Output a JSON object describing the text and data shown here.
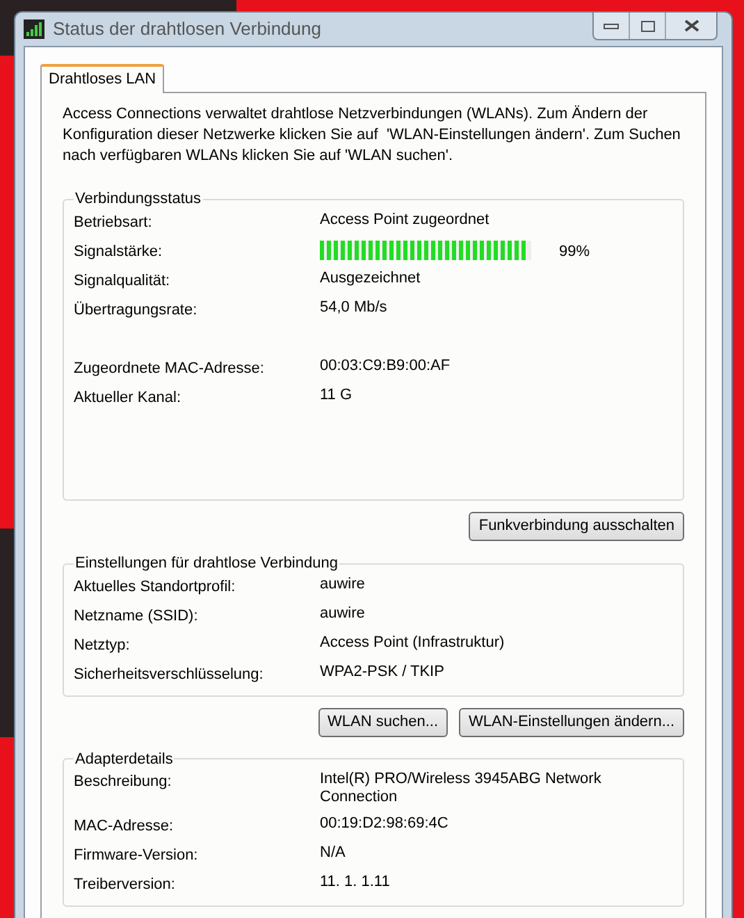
{
  "window": {
    "title": "Status der drahtlosen Verbindung"
  },
  "tabs": [
    {
      "label": "Drahtloses LAN",
      "selected": true
    }
  ],
  "intro": "Access Connections verwaltet drahtlose Netzverbindungen (WLANs). Zum Ändern der Konfiguration dieser Netzwerke klicken Sie auf  'WLAN-Einstellungen ändern'. Zum Suchen nach verfügbaren WLANs klicken Sie auf 'WLAN suchen'.",
  "connection_status": {
    "title": "Verbindungsstatus",
    "rows": [
      {
        "kind": "text",
        "label": "Betriebsart:",
        "value": "Access Point zugeordnet"
      },
      {
        "kind": "meter",
        "label": "Signalstärke:",
        "level": 0.99,
        "value": "99%"
      },
      {
        "kind": "text",
        "label": "Signalqualität:",
        "value": "Ausgezeichnet"
      },
      {
        "kind": "text",
        "label": "Übertragungsrate:",
        "value": "54,0 Mb/s"
      }
    ],
    "more_rows": [
      {
        "kind": "text",
        "label": "Zugeordnete MAC-Adresse:",
        "value": "00:03:C9:B9:00:AF"
      },
      {
        "kind": "text",
        "label": "Aktueller Kanal:",
        "value": "11 G"
      }
    ],
    "buttons": [
      "Funkverbindung ausschalten"
    ]
  },
  "wireless_settings": {
    "title": "Einstellungen für drahtlose Verbindung",
    "rows": [
      {
        "kind": "text",
        "label": "Aktuelles Standortprofil:",
        "value": "auwire"
      },
      {
        "kind": "text",
        "label": "Netzname (SSID):",
        "value": "auwire"
      },
      {
        "kind": "text",
        "label": "Netztyp:",
        "value": "Access Point (Infrastruktur)"
      },
      {
        "kind": "text",
        "label": "Sicherheitsverschlüsselung:",
        "value": "WPA2-PSK / TKIP"
      }
    ],
    "buttons": [
      "WLAN suchen...",
      "WLAN-Einstellungen ändern..."
    ]
  },
  "adapter_details": {
    "title": "Adapterdetails",
    "rows": [
      {
        "kind": "text",
        "label": "Beschreibung:",
        "value": "Intel(R) PRO/Wireless 3945ABG Network Connection"
      },
      {
        "kind": "text",
        "label": "MAC-Adresse:",
        "value": "00:19:D2:98:69:4C"
      },
      {
        "kind": "text",
        "label": "Firmware-Version:",
        "value": "N/A"
      },
      {
        "kind": "text",
        "label": "Treiberversion:",
        "value": "11. 1. 1.11"
      }
    ]
  }
}
